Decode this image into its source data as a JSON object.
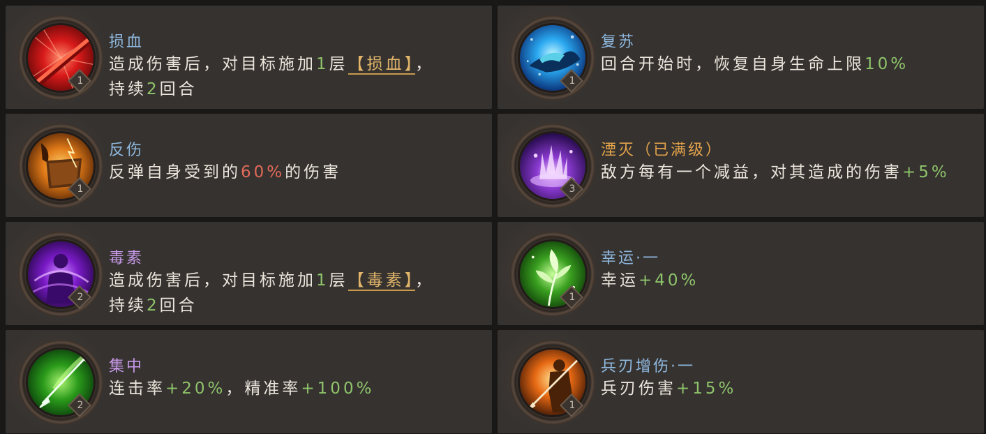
{
  "colors": {
    "blue_name": "#8fb8de",
    "orange_name": "#e2a24a",
    "purple_name": "#c89ae8",
    "value_green": "#8fc46a",
    "value_red": "#e26a58",
    "tag_gold": "#e2b56a"
  },
  "skills": [
    {
      "id": "sunxue",
      "icon": "blood-slash-icon",
      "name": "损血",
      "name_color": "blue",
      "level": "1",
      "desc": [
        "造成伤害后，对目标施加",
        "1",
        "层",
        "【损血】",
        "，持续",
        "2",
        "回合"
      ]
    },
    {
      "id": "fusu",
      "icon": "revive-ship-icon",
      "name": "复苏",
      "name_color": "blue",
      "level": "1",
      "desc": [
        "回合开始时，恢复自身生命上限",
        "10%"
      ]
    },
    {
      "id": "fanshang",
      "icon": "shield-reflect-icon",
      "name": "反伤",
      "name_color": "blue",
      "level": "1",
      "desc": [
        "反弹自身受到的",
        "60%",
        "的伤害"
      ]
    },
    {
      "id": "yanmie",
      "icon": "splash-icon",
      "name": "湮灭（已满级）",
      "name_color": "orange",
      "level": "3",
      "desc": [
        "敌方每有一个减益，对其造成的伤害",
        "+5%"
      ]
    },
    {
      "id": "dusu",
      "icon": "poison-figure-icon",
      "name": "毒素",
      "name_color": "purple",
      "level": "2",
      "desc": [
        "造成伤害后，对目标施加",
        "1",
        "层",
        "【毒素】",
        "，持续",
        "2",
        "回合"
      ]
    },
    {
      "id": "xingyun",
      "icon": "leaf-sprout-icon",
      "name": "幸运·一",
      "name_color": "blue",
      "level": "1",
      "desc": [
        "幸运",
        "+40%"
      ]
    },
    {
      "id": "jizhong",
      "icon": "arrow-focus-icon",
      "name": "集中",
      "name_color": "purple",
      "level": "2",
      "desc": [
        "连击率",
        "+20%",
        "，精准率",
        "+100%"
      ]
    },
    {
      "id": "bingren",
      "icon": "warrior-spear-icon",
      "name": "兵刃增伤·一",
      "name_color": "blue",
      "level": "1",
      "desc": [
        "兵刃伤害",
        "+15%"
      ]
    }
  ]
}
